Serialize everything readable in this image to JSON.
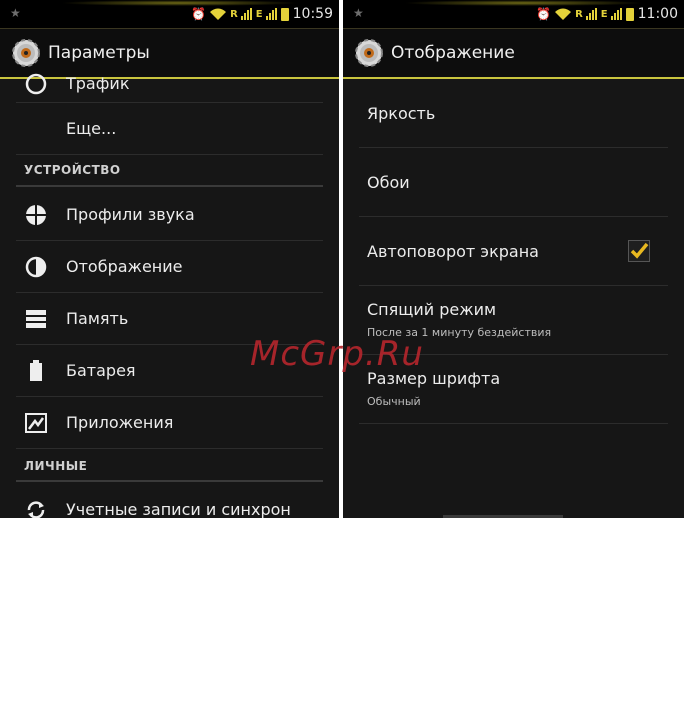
{
  "left": {
    "status": {
      "time": "10:59"
    },
    "header": {
      "title": "Параметры"
    },
    "items": {
      "traffic": "Трафик",
      "more": "Еще...",
      "section_device": "УСТРОЙСТВО",
      "sound": "Профили звука",
      "display": "Отображение",
      "memory": "Память",
      "battery": "Батарея",
      "apps": "Приложения",
      "section_personal": "ЛИЧНЫЕ",
      "accounts": "Учетные записи и синхрон"
    }
  },
  "right": {
    "status": {
      "time": "11:00"
    },
    "header": {
      "title": "Отображение"
    },
    "items": {
      "brightness": "Яркость",
      "wallpaper": "Обои",
      "autorotate": "Автоповорот экрана",
      "autorotate_checked": true,
      "sleep": "Спящий режим",
      "sleep_sub": "После за 1 минуту бездействия",
      "font_size": "Размер шрифта",
      "font_size_sub": "Обычный"
    }
  },
  "watermark": "McGrp.Ru",
  "colors": {
    "accent": "#c9c43e",
    "status_icons": "#e4d23a",
    "check": "#e8b820",
    "watermark": "#b3262c"
  }
}
